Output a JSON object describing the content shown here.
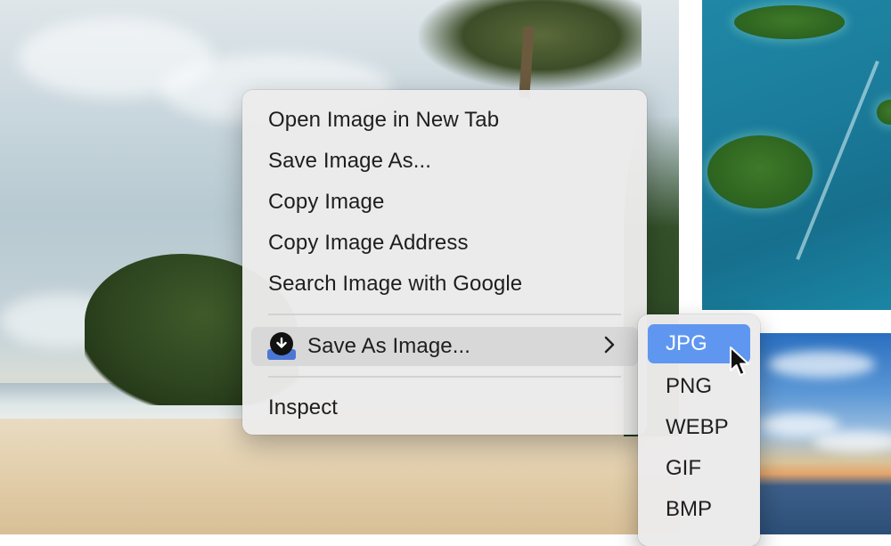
{
  "context_menu": {
    "items": [
      {
        "label": "Open Image in New Tab"
      },
      {
        "label": "Save Image As..."
      },
      {
        "label": "Copy Image"
      },
      {
        "label": "Copy Image Address"
      },
      {
        "label": "Search Image with Google"
      }
    ],
    "extension_item": {
      "label": "Save As Image...",
      "icon": "download-circle-icon",
      "has_submenu": true
    },
    "inspect": {
      "label": "Inspect"
    }
  },
  "submenu": {
    "options": [
      {
        "label": "JPG"
      },
      {
        "label": "PNG"
      },
      {
        "label": "WEBP"
      },
      {
        "label": "GIF"
      },
      {
        "label": "BMP"
      }
    ],
    "selected": "JPG",
    "highlight_color": "#5f97f0"
  },
  "background_images": {
    "left": "tropical-beach-photo",
    "top_right": "aerial-islands-photo",
    "bottom_right": "sunset-sea-photo"
  }
}
